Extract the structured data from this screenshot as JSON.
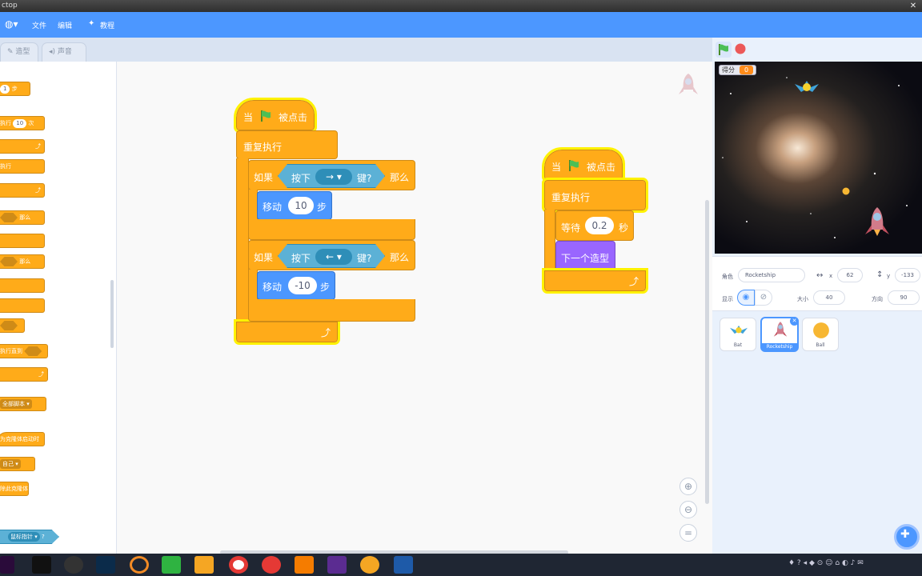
{
  "window": {
    "title": "ctop",
    "close_label": "✕"
  },
  "menubar": {
    "file": "文件",
    "edit": "编辑",
    "tutorial": "教程"
  },
  "tabs": {
    "costumes": "造型",
    "sounds": "声音"
  },
  "palette": {
    "items": [
      "1",
      "步",
      "执行",
      "10",
      "次",
      "执行",
      "那么",
      "那么",
      "执行直到",
      "全部脚本",
      "为克隆体启动时",
      "自己",
      "除此克隆体",
      "鼠标指针"
    ],
    "move_steps_value": "1",
    "repeat_value": "10"
  },
  "scripts": {
    "left": {
      "hat_when": "当",
      "hat_clicked": "被点击",
      "forever": "重复执行",
      "if1": {
        "if_label": "如果",
        "key_pressed": "按下",
        "key": "→",
        "key_q": "键?",
        "then": "那么",
        "move": "移动",
        "steps_value": "10",
        "steps": "步"
      },
      "if2": {
        "if_label": "如果",
        "key_pressed": "按下",
        "key": "←",
        "key_q": "键?",
        "then": "那么",
        "move": "移动",
        "steps_value": "-10",
        "steps": "步"
      }
    },
    "right": {
      "hat_when": "当",
      "hat_clicked": "被点击",
      "forever": "重复执行",
      "wait": "等待",
      "wait_value": "0.2",
      "seconds": "秒",
      "next_costume": "下一个造型"
    }
  },
  "stage": {
    "score_label": "得分",
    "score_value": "0"
  },
  "sprite_info": {
    "sprite_label": "角色",
    "sprite_name": "Rocketship",
    "x_label": "x",
    "x_value": "62",
    "y_label": "y",
    "y_value": "-133",
    "show_label": "显示",
    "size_label": "大小",
    "size_value": "40",
    "direction_label": "方向",
    "direction_value": "90"
  },
  "sprites": [
    {
      "name": "Bat"
    },
    {
      "name": "Rocketship"
    },
    {
      "name": "Ball"
    }
  ],
  "colors": {
    "accent": "#4c97ff",
    "control": "#ffab19",
    "motion": "#4c97ff",
    "looks": "#9966ff",
    "sensing": "#5cb1d6",
    "highlight": "#fff200"
  }
}
